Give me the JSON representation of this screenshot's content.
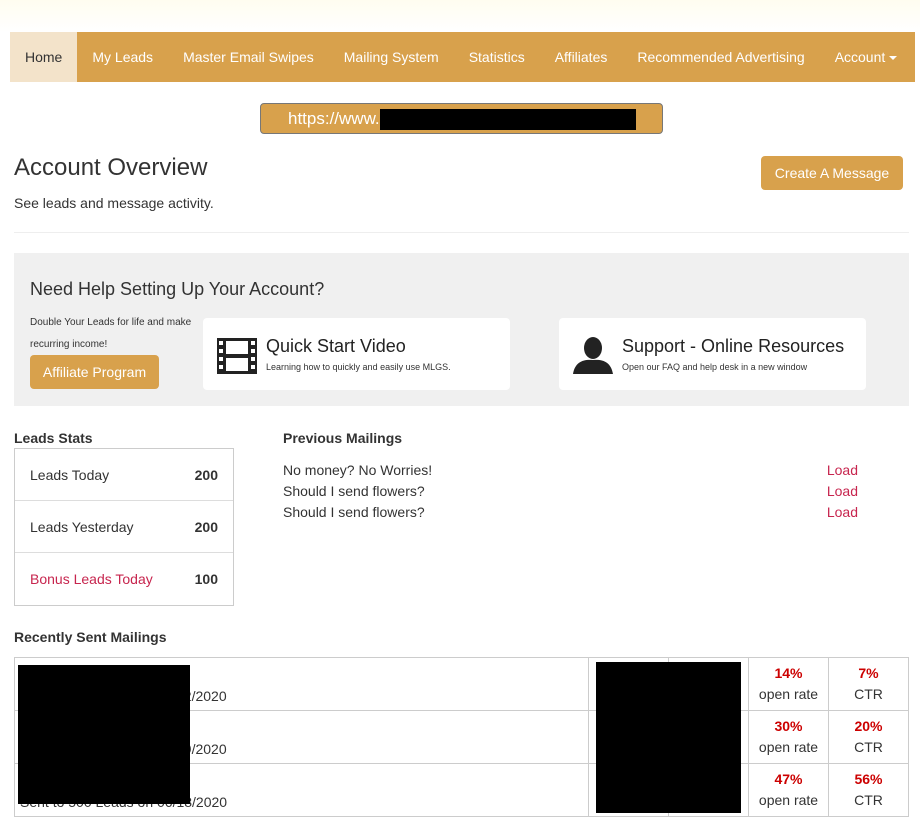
{
  "nav": {
    "items": [
      {
        "label": "Home",
        "active": true
      },
      {
        "label": "My Leads"
      },
      {
        "label": "Master Email Swipes"
      },
      {
        "label": "Mailing System"
      },
      {
        "label": "Statistics"
      },
      {
        "label": "Affiliates"
      },
      {
        "label": "Recommended Advertising"
      },
      {
        "label": "Account"
      }
    ]
  },
  "url_bar": {
    "prefix": "https://www."
  },
  "header": {
    "title": "Account Overview",
    "subtitle": "See leads and message activity.",
    "create_button": "Create A Message"
  },
  "help": {
    "title": "Need Help Setting Up Your Account?",
    "affiliate_text": "Double Your Leads for life and make recurring income!",
    "affiliate_button": "Affiliate Program",
    "cards": [
      {
        "title": "Quick Start Video",
        "desc": "Learning how to quickly and easily use MLGS.",
        "icon": "film-icon"
      },
      {
        "title": "Support - Online Resources",
        "desc": "Open our FAQ and help desk in a new window",
        "icon": "user-icon"
      }
    ]
  },
  "leads_stats": {
    "title": "Leads Stats",
    "rows": [
      {
        "label": "Leads Today",
        "value": "200"
      },
      {
        "label": "Leads Yesterday",
        "value": "200"
      },
      {
        "label": "Bonus Leads Today",
        "value": "100"
      }
    ]
  },
  "previous_mailings": {
    "title": "Previous Mailings",
    "items": [
      {
        "subject": "No money? No Worries!",
        "action": "Load"
      },
      {
        "subject": "Should I send flowers?",
        "action": "Load"
      },
      {
        "subject": "Should I send flowers?",
        "action": "Load"
      }
    ]
  },
  "recent": {
    "title": "Recently Sent Mailings",
    "rows": [
      {
        "sent": "22/2020",
        "open_rate": "14%",
        "open_label": "open rate",
        "ctr": "7%",
        "ctr_label": "CTR"
      },
      {
        "sent": "19/2020",
        "open_rate": "30%",
        "open_label": "open rate",
        "ctr": "20%",
        "ctr_label": "CTR"
      },
      {
        "sent": "Sent to 500 Leads on 06/18/2020",
        "open_rate": "47%",
        "open_label": "open rate",
        "ctr": "56%",
        "ctr_label": "CTR"
      }
    ]
  },
  "colors": {
    "accent": "#d8a14c",
    "active_tab": "#f3e3ca",
    "link": "#c7254e",
    "stat_red": "#cc0000"
  }
}
